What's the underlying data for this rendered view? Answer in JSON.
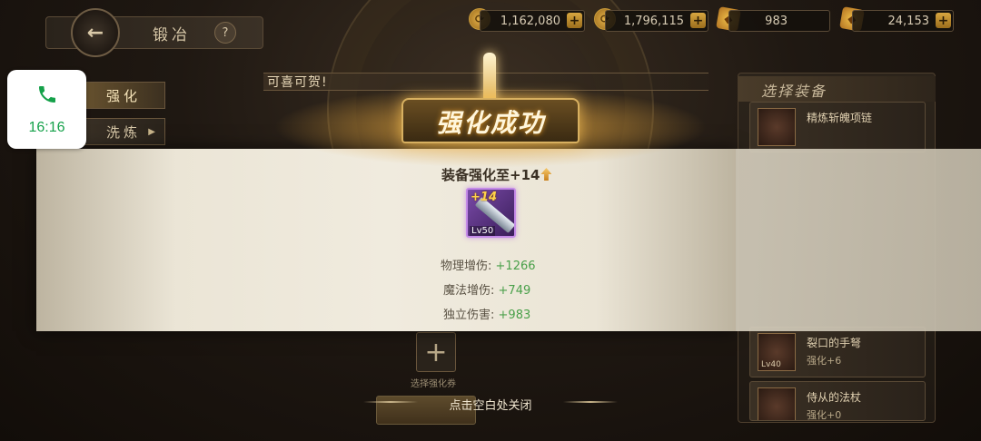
{
  "header": {
    "back_label": "←",
    "title": "锻冶",
    "help_label": "?"
  },
  "resources": [
    {
      "icon": "coin-icon",
      "value": "1,162,080"
    },
    {
      "icon": "coin-icon",
      "value": "1,796,115"
    },
    {
      "icon": "gem-icon",
      "value": "983"
    },
    {
      "icon": "gem-icon",
      "value": "24,153"
    }
  ],
  "plus_label": "+",
  "tabs": [
    {
      "label": "强化"
    },
    {
      "label": "洗炼"
    }
  ],
  "banner": {
    "text": "可喜可贺!"
  },
  "equip_panel": {
    "title": "选择装备",
    "items": [
      {
        "name": "精炼斩魄项链",
        "sub": "",
        "lv": ""
      },
      {
        "name": "裂口的手弩",
        "sub": "强化+6",
        "lv": "Lv40"
      },
      {
        "name": "侍从的法杖",
        "sub": "强化+0",
        "lv": ""
      }
    ]
  },
  "select_slot": {
    "label": "选择强化券"
  },
  "popup": {
    "title": "强化成功",
    "enhance_text": "装备强化至+14",
    "item": {
      "plus": "+14",
      "level": "Lv50"
    },
    "stats": [
      {
        "label": "物理增伤:",
        "value": "+1266"
      },
      {
        "label": "魔法增伤:",
        "value": "+749"
      },
      {
        "label": "独立伤害:",
        "value": "+983"
      }
    ],
    "close_hint": "点击空白处关闭"
  },
  "call_widget": {
    "time": "16:16"
  }
}
